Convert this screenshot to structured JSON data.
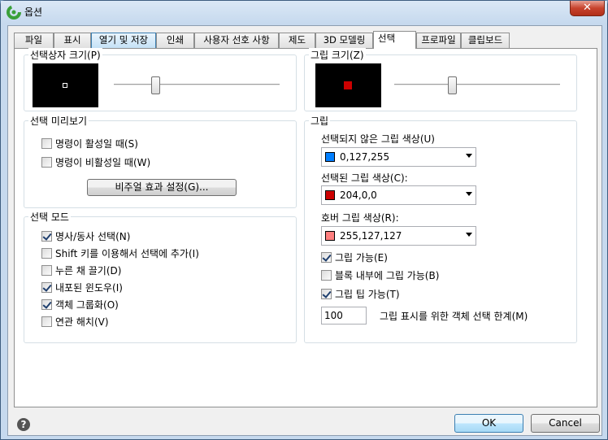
{
  "window": {
    "title": "옵션",
    "close_label": "✕"
  },
  "tabs": [
    {
      "label": "파일"
    },
    {
      "label": "표시"
    },
    {
      "label": "열기 및 저장"
    },
    {
      "label": "인쇄"
    },
    {
      "label": "사용자 선호 사항"
    },
    {
      "label": "제도"
    },
    {
      "label": "3D 모델링"
    },
    {
      "label": "선택"
    },
    {
      "label": "프로파일"
    },
    {
      "label": "클립보드"
    }
  ],
  "active_tab": "선택",
  "pickbox": {
    "label": "선택상자 크기(P)",
    "slider_level": 0.25
  },
  "grip_size": {
    "label": "그립 크기(Z)",
    "slider_level": 0.35
  },
  "selection_preview": {
    "label": "선택 미리보기",
    "when_command_active": {
      "label": "명령이 활성일 때(S)",
      "checked": false
    },
    "when_no_command": {
      "label": "명령이 비활성일 때(W)",
      "checked": false
    },
    "visual_effects_button": "비주얼 효과 설정(G)..."
  },
  "selection_modes": {
    "label": "선택 모드",
    "items": [
      {
        "label": "명사/동사 선택(N)",
        "checked": true
      },
      {
        "label": "Shift 키를 이용해서 선택에 추가(I)",
        "checked": false
      },
      {
        "label": "누른 채 끌기(D)",
        "checked": false
      },
      {
        "label": "내포된 윈도우(I)",
        "checked": true
      },
      {
        "label": "객체 그룹화(O)",
        "checked": true
      },
      {
        "label": "연관 해치(V)",
        "checked": false
      }
    ]
  },
  "grips": {
    "label": "그립",
    "unselected_color": {
      "label": "선택되지 않은 그립 색상(U)",
      "value": "0,127,255",
      "swatch": "#007fff"
    },
    "selected_color": {
      "label": "선택된 그립 색상(C):",
      "value": "204,0,0",
      "swatch": "#cc0000"
    },
    "hover_color": {
      "label": "호버 그립 색상(R):",
      "value": "255,127,127",
      "swatch": "#ff7f7f"
    },
    "enable_grips": {
      "label": "그립 가능(E)",
      "checked": true
    },
    "grips_in_blocks": {
      "label": "블록 내부에 그립 가능(B)",
      "checked": false
    },
    "grip_tips": {
      "label": "그립 팁 가능(T)",
      "checked": true
    },
    "limit_value": "100",
    "limit_label": "그립 표시를 위한 객체 선택 한계(M)"
  },
  "buttons": {
    "ok": "OK",
    "cancel": "Cancel"
  },
  "help_label": "?"
}
